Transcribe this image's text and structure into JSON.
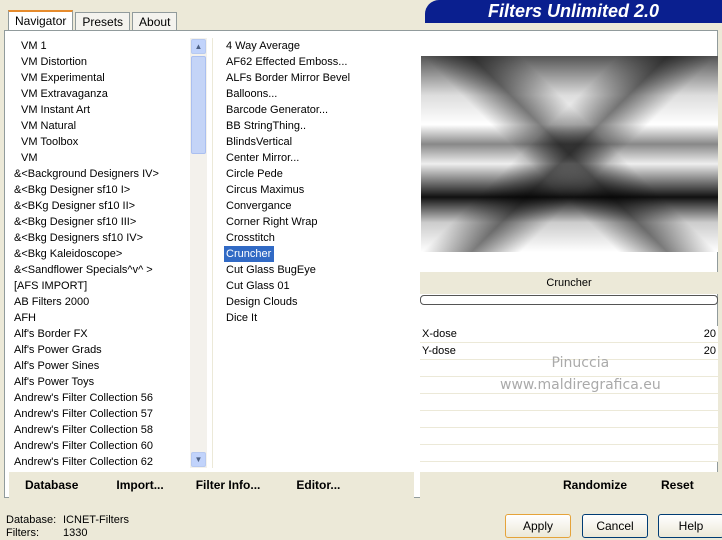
{
  "title": "Filters Unlimited 2.0",
  "tabs": [
    "Navigator",
    "Presets",
    "About"
  ],
  "categories": [
    "VM 1",
    "VM Distortion",
    "VM Experimental",
    "VM Extravaganza",
    "VM Instant Art",
    "VM Natural",
    "VM Toolbox",
    "VM",
    "&<Background Designers IV>",
    "&<Bkg Designer sf10 I>",
    "&<BKg Designer sf10 II>",
    "&<Bkg Designer sf10 III>",
    "&<Bkg Designers sf10 IV>",
    "&<Bkg Kaleidoscope>",
    "&<Sandflower Specials^v^ >",
    "[AFS IMPORT]",
    "AB Filters 2000",
    "AFH",
    "Alf's Border FX",
    "Alf's Power Grads",
    "Alf's Power Sines",
    "Alf's Power Toys",
    "Andrew's Filter Collection 56",
    "Andrew's Filter Collection 57",
    "Andrew's Filter Collection 58",
    "Andrew's Filter Collection 60",
    "Andrew's Filter Collection 62"
  ],
  "filters": [
    "4 Way Average",
    "AF62 Effected Emboss...",
    "ALFs Border Mirror Bevel",
    "Balloons...",
    "Barcode Generator...",
    "BB StringThing..",
    "BlindsVertical",
    "Center Mirror...",
    "Circle Pede",
    "Circus Maximus",
    "Convergance",
    "Corner Right Wrap",
    "Crosstitch",
    "Cruncher",
    "Cut Glass  BugEye",
    "Cut Glass 01",
    "Design Clouds",
    "Dice It"
  ],
  "selected_filter": "Cruncher",
  "params": [
    {
      "label": "X-dose",
      "value": "20"
    },
    {
      "label": "Y-dose",
      "value": "20"
    }
  ],
  "watermark": [
    "Pinuccia",
    "www.maldiregrafica.eu"
  ],
  "bottom_left": [
    "Database",
    "Import...",
    "Filter Info...",
    "Editor..."
  ],
  "bottom_right": [
    "Randomize",
    "Reset"
  ],
  "status": {
    "db_label": "Database:",
    "db_value": "ICNET-Filters",
    "filters_label": "Filters:",
    "filters_value": "1330"
  },
  "buttons": {
    "apply": "Apply",
    "cancel": "Cancel",
    "help": "Help"
  }
}
